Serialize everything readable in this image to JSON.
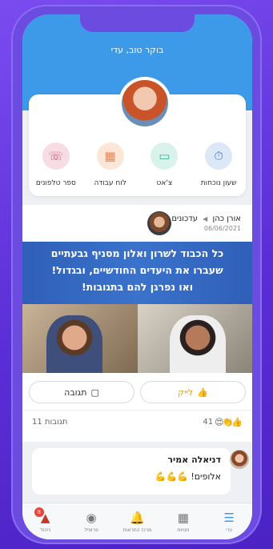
{
  "greeting": "בוקר טוב, עדי",
  "quick_actions": [
    {
      "label": "ספר טלפונים",
      "icon": "phone-icon",
      "color": "#f7dce4",
      "fg": "#d0587a"
    },
    {
      "label": "לוח עבודה",
      "icon": "calendar-icon",
      "color": "#fde6d8",
      "fg": "#e08a5a"
    },
    {
      "label": "צ'אט",
      "icon": "chat-icon",
      "color": "#d9f3ec",
      "fg": "#3fae8c"
    },
    {
      "label": "שעון נוכחות",
      "icon": "stopwatch-icon",
      "color": "#dce8f7",
      "fg": "#3d7fd0"
    }
  ],
  "post": {
    "author": "אורן כהן",
    "channel": "עדכונים",
    "date": "06/06/2021",
    "banner_lines": [
      "כל הכבוד לשרון ואלון מסניף גבעתיים",
      "שעברו את היעדים החודשיים, ובגדול!",
      "ואו נפרגן להם בתגובות!"
    ],
    "like_label": "לייק",
    "comment_label": "תגובה",
    "reactions_count": "41",
    "comments_count": "11 תגובות"
  },
  "comment": {
    "name": "דניאלה אמיר",
    "text": "אלופים! 💪💪💪"
  },
  "nav": [
    {
      "label": "עדי",
      "icon": "feed-icon",
      "active": true
    },
    {
      "label": "חנויות",
      "icon": "grid-icon",
      "active": false
    },
    {
      "label": "מרכז התראות",
      "icon": "bell-icon",
      "active": false
    },
    {
      "label": "פרופיל",
      "icon": "profile-icon",
      "active": false
    },
    {
      "label": "ניהול",
      "icon": "chart-icon",
      "active": false,
      "badge": "8"
    }
  ],
  "colors": {
    "header": "#3d9ae8",
    "accent": "#3d9ae8",
    "frame": "#6b4be0"
  }
}
